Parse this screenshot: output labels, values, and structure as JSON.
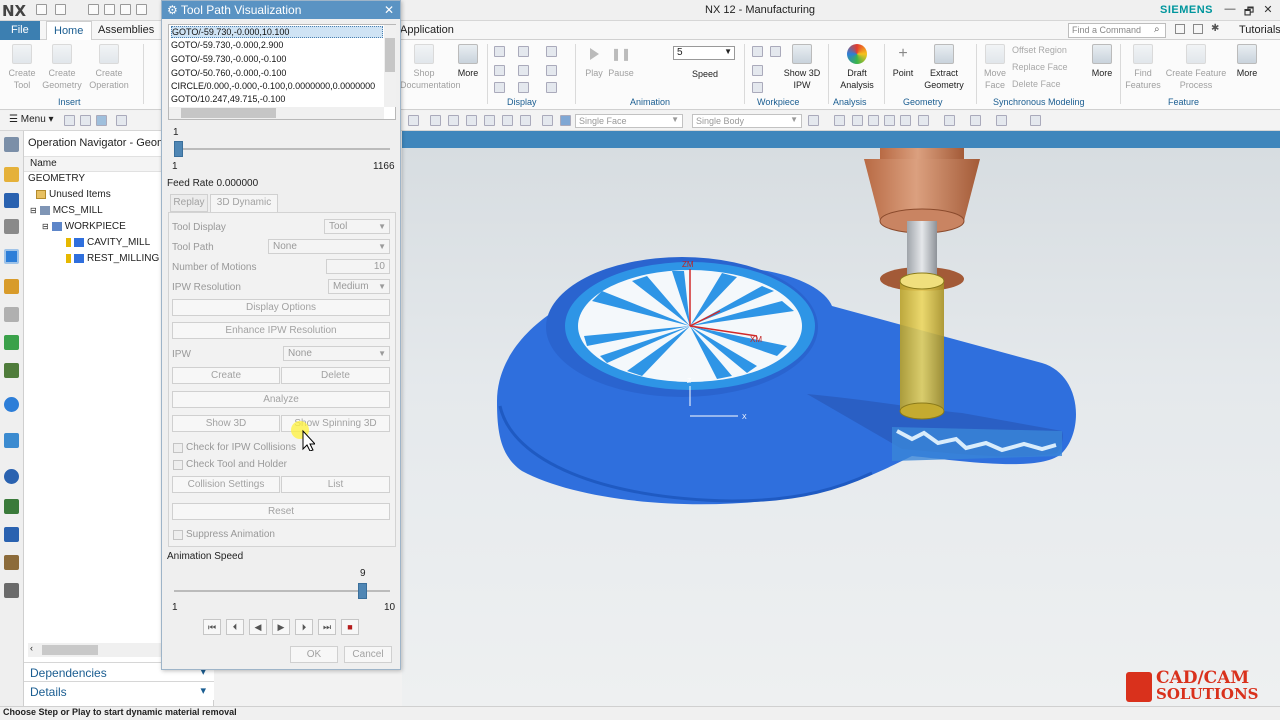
{
  "window": {
    "app_logo": "NX",
    "title": "NX 12 - Manufacturing",
    "brand": "SIEMENS",
    "controls": [
      "—",
      "🗗",
      "✕"
    ]
  },
  "menu": {
    "file": "File",
    "home": "Home",
    "assemblies": "Assemblies",
    "application": "Application",
    "search_placeholder": "Find a Command",
    "tutorials": "Tutorials"
  },
  "ribbon": {
    "insert": {
      "buttons": [
        "Create Tool",
        "Create Geometry",
        "Create Operation"
      ],
      "label": "Insert"
    },
    "shop_doc": "Shop Documentation",
    "more1": "More",
    "display_label": "Display",
    "animation": {
      "play": "Play",
      "pause": "Pause",
      "speed_value": "5",
      "speed": "Speed",
      "label": "Animation"
    },
    "workpiece": {
      "show_ipw": "Show 3D IPW",
      "label": "Workpiece"
    },
    "analysis": {
      "draft": "Draft Analysis",
      "label": "Analysis"
    },
    "geometry": {
      "point": "Point",
      "extract": "Extract Geometry",
      "label": "Geometry"
    },
    "sync": {
      "move_face": "Move Face",
      "offset_region": "Offset Region",
      "replace_face": "Replace Face",
      "delete_face": "Delete Face",
      "label": "Synchronous Modeling"
    },
    "more2": "More",
    "feature": {
      "find": "Find Features",
      "process": "Create Feature Process",
      "more": "More",
      "label": "Feature"
    }
  },
  "toolbar2": {
    "menu": "Menu",
    "face_filter": "Single Face",
    "body_filter": "Single Body"
  },
  "navigator": {
    "title": "Operation Navigator - Geome",
    "col_name": "Name",
    "tree": [
      {
        "label": "GEOMETRY"
      },
      {
        "label": "Unused Items"
      },
      {
        "label": "MCS_MILL"
      },
      {
        "label": "WORKPIECE"
      },
      {
        "label": "CAVITY_MILL"
      },
      {
        "label": "REST_MILLING"
      }
    ],
    "dependencies": "Dependencies",
    "details": "Details"
  },
  "dialog": {
    "title": "Tool Path Visualization",
    "goto_lines": [
      "GOTO/-59.730,-0.000,10.100",
      "GOTO/-59.730,-0.000,2.900",
      "GOTO/-59.730,-0.000,-0.100",
      "GOTO/-50.760,-0.000,-0.100",
      "CIRCLE/0.000,-0.000,-0.100,0.0000000,0.0000000",
      "GOTO/10.247,49.715,-0.100"
    ],
    "motion_slider": {
      "value": "1",
      "min": "1",
      "max": "1166",
      "fraction": 0.0
    },
    "feed_rate": "Feed Rate 0.000000",
    "tabs": [
      "Replay",
      "3D Dynamic"
    ],
    "tool_display_label": "Tool Display",
    "tool_display_value": "Tool",
    "tool_path_label": "Tool Path",
    "tool_path_value": "None",
    "motions_label": "Number of Motions",
    "motions_value": "10",
    "ipw_res_label": "IPW Resolution",
    "ipw_res_value": "Medium",
    "display_options": "Display Options",
    "enhance_ipw": "Enhance IPW Resolution",
    "ipw_label": "IPW",
    "ipw_value": "None",
    "create": "Create",
    "delete": "Delete",
    "analyze": "Analyze",
    "show3d": "Show 3D",
    "show_spinning": "Show Spinning 3D",
    "check_ipw": "Check for IPW Collisions",
    "check_holder": "Check Tool and Holder",
    "collision_settings": "Collision Settings",
    "list": "List",
    "reset": "Reset",
    "suppress": "Suppress Animation",
    "anim_speed_label": "Animation Speed",
    "anim_slider": {
      "value": "9",
      "min": "1",
      "max": "10",
      "fraction": 0.8889
    },
    "ok": "OK",
    "cancel": "Cancel"
  },
  "viewport": {
    "axis_xm": "XM",
    "axis_zm": "ZM",
    "axis_x": "X",
    "axis_z": "Z"
  },
  "status": "Choose Step or Play to start dynamic material removal",
  "logo_text": [
    "CAD/CAM",
    "SOLUTIONS"
  ],
  "colors": {
    "part_blue": "#2f6fdd",
    "accent": "#3c7fb1",
    "tool": "#c8794e",
    "logo_red": "#d9311c"
  }
}
